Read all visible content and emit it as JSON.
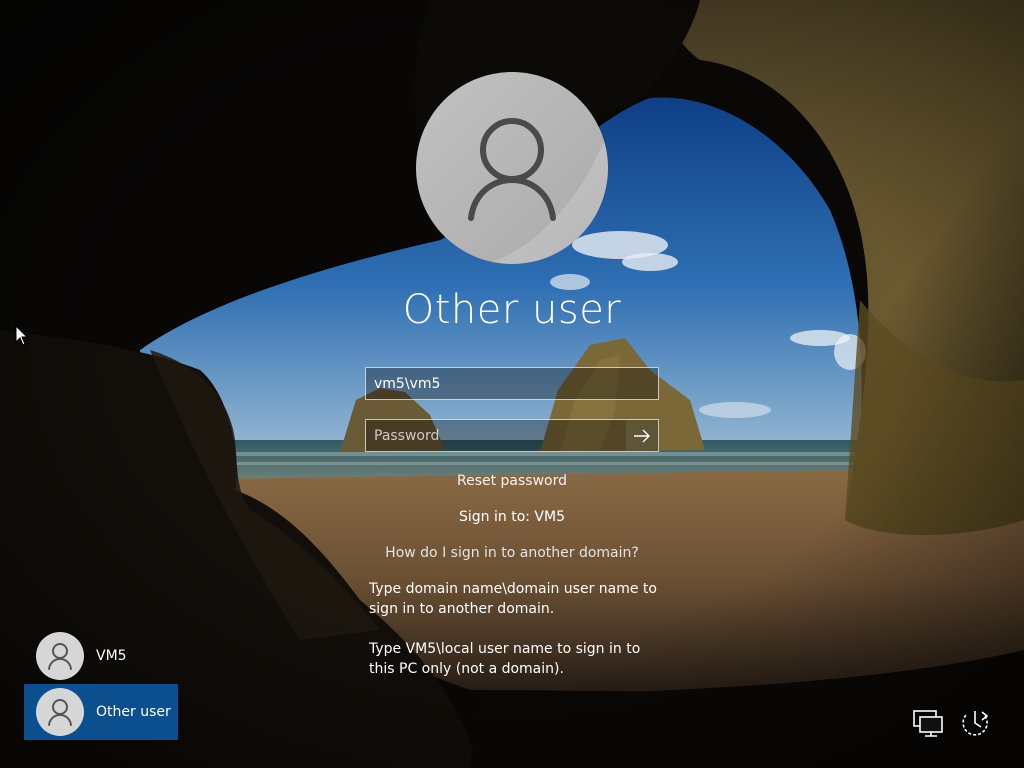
{
  "login": {
    "title": "Other user",
    "username_value": "vm5\\vm5",
    "password_placeholder": "Password",
    "reset_password": "Reset password",
    "sign_in_to": "Sign in to: VM5",
    "other_domain_link": "How do I sign in to another domain?",
    "help_domain": "Type domain name\\domain user name to sign in to another domain.",
    "help_local": "Type VM5\\local user name to sign in to this PC only (not a domain)."
  },
  "users": [
    {
      "label": "VM5",
      "selected": false
    },
    {
      "label": "Other user",
      "selected": true
    }
  ],
  "icons": {
    "avatar": "user-avatar-icon",
    "submit": "arrow-right-icon",
    "network": "network-icon",
    "power": "power-icon",
    "cursor": "mouse-pointer-icon"
  },
  "colors": {
    "selected_tile": "#0b4f8e",
    "avatar_bg": "#b8b8b8",
    "avatar_glyph": "#444444"
  }
}
